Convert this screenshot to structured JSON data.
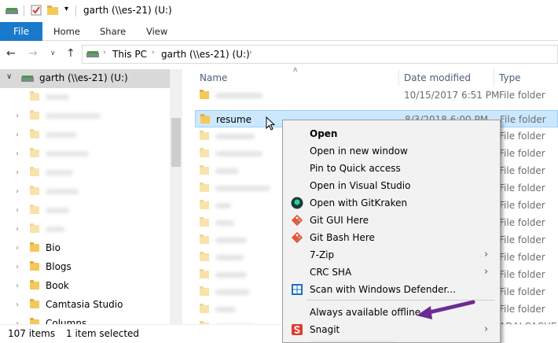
{
  "window": {
    "title": "garth (\\\\es-21) (U:)"
  },
  "ribbon": {
    "tabs": [
      "File",
      "Home",
      "Share",
      "View"
    ]
  },
  "address": {
    "crumbs": [
      "This PC",
      "garth (\\\\es-21) (U:)"
    ]
  },
  "navpane": {
    "root": "garth (\\\\es-21) (U:)",
    "folders": [
      "Bio",
      "Blogs",
      "Book",
      "Camtasia Studio",
      "Columns"
    ]
  },
  "filelist": {
    "headers": {
      "name": "Name",
      "date": "Date modified",
      "type": "Type"
    },
    "rows": [
      {
        "name": "",
        "date": "10/15/2017 6:51 PM",
        "type": "File folder"
      },
      {
        "name": "resume",
        "date": "8/3/2018 6:00 PM",
        "type": "File folder"
      }
    ],
    "type_label": "File folder",
    "partial_row_type": "ADALCACHE F"
  },
  "context_menu": {
    "items": [
      {
        "label": "Open",
        "bold": true
      },
      {
        "label": "Open in new window"
      },
      {
        "label": "Pin to Quick access"
      },
      {
        "label": "Open in Visual Studio"
      },
      {
        "label": "Open with GitKraken",
        "icon": "gitkraken-icon"
      },
      {
        "label": "Git GUI Here",
        "icon": "git-icon"
      },
      {
        "label": "Git Bash Here",
        "icon": "git-icon"
      },
      {
        "label": "7-Zip",
        "submenu": true
      },
      {
        "label": "CRC SHA",
        "submenu": true
      },
      {
        "label": "Scan with Windows Defender...",
        "icon": "defender-icon"
      },
      {
        "label": "Always available offline"
      },
      {
        "label": "Snagit",
        "icon": "snagit-icon",
        "submenu": true
      }
    ]
  },
  "status": {
    "items": "107 items",
    "selected": "1 item selected"
  },
  "colors": {
    "accent": "#1979ca",
    "selection": "#cce8ff",
    "annotation": "#6b2c91"
  }
}
